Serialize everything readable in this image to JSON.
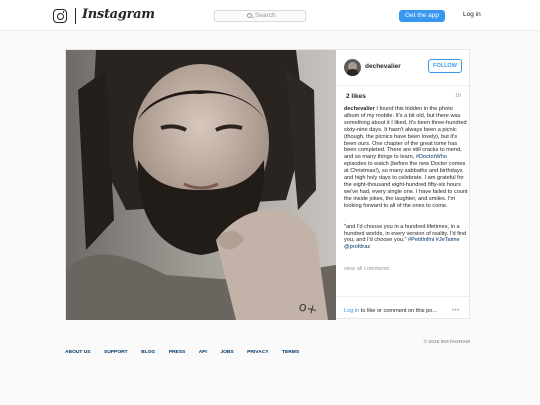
{
  "header": {
    "logo_text": "Instagram",
    "search_placeholder": "Search",
    "get_app_label": "Get the app",
    "login_label": "Log in"
  },
  "post": {
    "username": "dechevalier",
    "follow_label": "FOLLOW",
    "likes": "2 likes",
    "time_ago": "1h",
    "caption": {
      "user": "dechevalier",
      "text_before_tag": " I found this hidden in the photo album of my mobile. It's a bit old, but there was something about it I liked. It's been three-hundred sixty-nine days. It hasn't always been a picnic (though, the picnics have been lovely), but it's been ours. One chapter of the great tome has been completed. There are still cracks to mend, and so many things to learn, ",
      "hashtag": "#DoctorWho",
      "text_after_tag": " episodes to watch (before the new Doctor comes at Christmas!), so many sabbaths and birthdays and high holy days to celebrate. I am grateful for the eight-thousand eight-hundred fifty-six hours we've had, every single one. I have failed to count the inside jokes, the laughter, and smiles. I'm looking forward to all of the ones to come."
    },
    "dot": ".",
    "quote": {
      "text": "\"and I'd choose you in a hundred lifetimes, in a hundred worlds, in every version of reality. I'd find you, and I'd choose you.\" ",
      "tag1": "#PetitInfini",
      "tag2": "#JeTaime",
      "mention": "@profdraz"
    },
    "view_all_label": "view all comments",
    "login_link": "Log in",
    "login_suffix": " to like or comment on this po...",
    "more_icon": "more-options-icon",
    "more_glyph": "•••"
  },
  "footer": {
    "links": [
      "ABOUT US",
      "SUPPORT",
      "BLOG",
      "PRESS",
      "API",
      "JOBS",
      "PRIVACY",
      "TERMS"
    ],
    "copyright": "© 2016 INSTAGRAM"
  },
  "colors": {
    "accent": "#3897f0",
    "link": "#003569",
    "muted": "#999999",
    "text": "#262626",
    "background": "#fafafa"
  }
}
